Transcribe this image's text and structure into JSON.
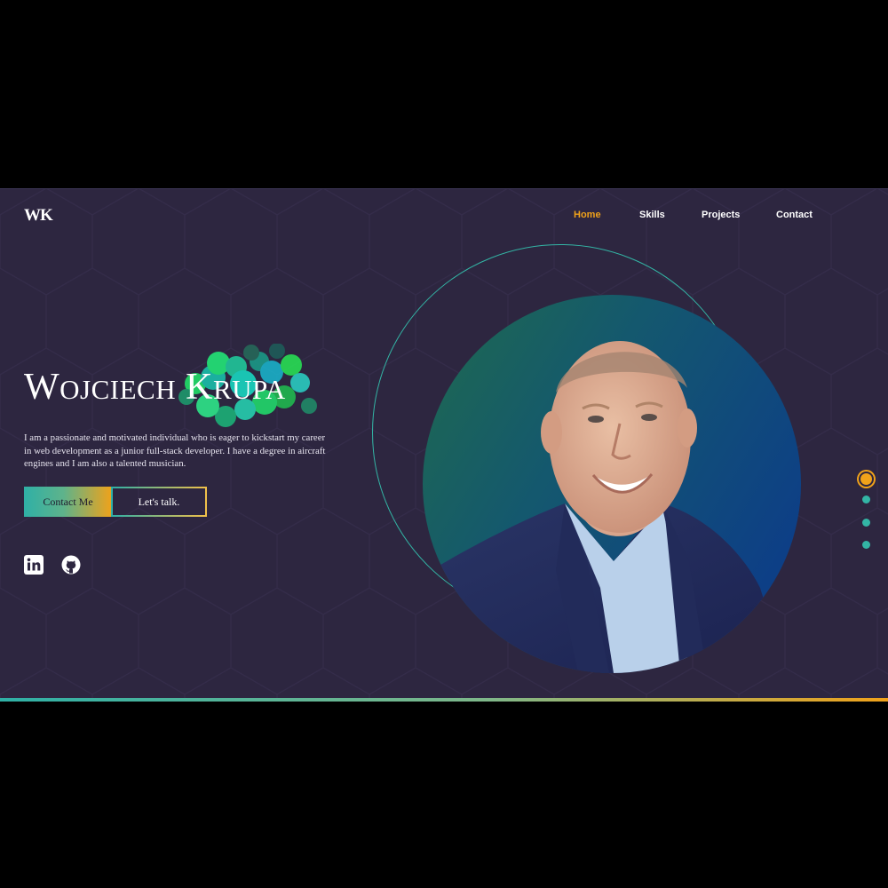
{
  "brand": {
    "logo": "WK"
  },
  "nav": {
    "items": [
      {
        "label": "Home",
        "active": true
      },
      {
        "label": "Skills",
        "active": false
      },
      {
        "label": "Projects",
        "active": false
      },
      {
        "label": "Contact",
        "active": false
      }
    ]
  },
  "hero": {
    "name_first_initial": "W",
    "name_first_rest": "OJCIECH",
    "name_last_initial": "K",
    "name_last_rest": "RUPA",
    "bio": "I am a passionate and motivated individual who is eager to kickstart my career in web development as a junior full-stack developer. I have a degree in aircraft engines and I am also a talented musician.",
    "contact_button": "Contact Me",
    "talk_button": "Let's talk."
  },
  "social": [
    {
      "icon": "linkedin-icon"
    },
    {
      "icon": "github-icon"
    }
  ],
  "slider": {
    "count": 4,
    "active_index": 0
  },
  "colors": {
    "background": "#2d2640",
    "accent_orange": "#f0a21a",
    "accent_teal": "#33b5a5"
  }
}
